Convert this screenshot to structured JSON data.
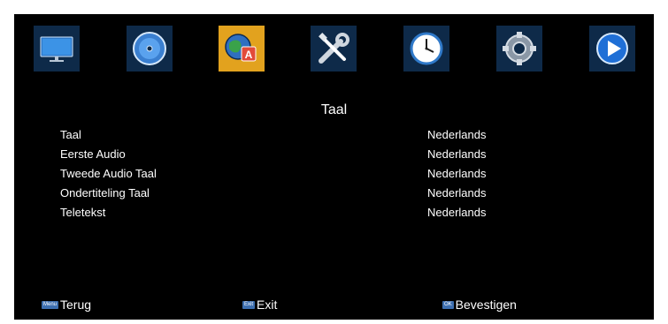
{
  "menu": {
    "icons": [
      {
        "name": "tv-icon"
      },
      {
        "name": "disc-icon"
      },
      {
        "name": "language-globe-icon",
        "active": true
      },
      {
        "name": "tools-icon"
      },
      {
        "name": "clock-icon"
      },
      {
        "name": "gear-icon"
      },
      {
        "name": "play-icon"
      }
    ],
    "active_color": "#e2a21e",
    "tile_color": "#0e2a49"
  },
  "page": {
    "title": "Taal",
    "rows": [
      {
        "label": "Taal",
        "value": "Nederlands"
      },
      {
        "label": "Eerste Audio",
        "value": "Nederlands"
      },
      {
        "label": "Tweede Audio Taal",
        "value": "Nederlands"
      },
      {
        "label": "Ondertiteling Taal",
        "value": "Nederlands"
      },
      {
        "label": "Teletekst",
        "value": "Nederlands"
      }
    ]
  },
  "footer": {
    "back_key": "Menu",
    "back_label": "Terug",
    "exit_key": "Exit",
    "exit_label": "Exit",
    "ok_key": "OK",
    "ok_label": "Bevestigen"
  }
}
